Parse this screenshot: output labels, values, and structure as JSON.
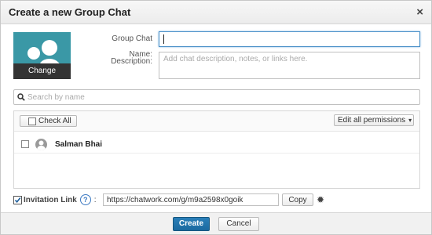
{
  "dialog": {
    "title": "Create a new Group Chat",
    "close_glyph": "×"
  },
  "avatar": {
    "change_label": "Change",
    "icon": "group-avatar-icon"
  },
  "form": {
    "name_label": "Group Chat Name:",
    "name_label_line1": "Group Chat",
    "name_label_line2": "Name:",
    "name_value": "",
    "description_label": "Description:",
    "description_placeholder": "Add chat description, notes, or links here."
  },
  "search": {
    "placeholder": "Search by name",
    "icon": "search-icon"
  },
  "members": {
    "check_all_label": "Check All",
    "edit_permissions_label": "Edit all permissions",
    "dropdown_glyph": "▾",
    "items": [
      {
        "name": "Salman Bhai",
        "checked": false
      }
    ]
  },
  "invite": {
    "label": "Invitation Link",
    "checked": true,
    "help_glyph": "?",
    "colon": ":",
    "link": "https://chatwork.com/g/m9a2598x0goik",
    "copy_label": "Copy",
    "gear_glyph": "✹"
  },
  "footer": {
    "create_label": "Create",
    "cancel_label": "Cancel"
  },
  "colors": {
    "accent": "#1b6aa0",
    "avatar_bg": "#3a98a6",
    "focus": "#4a90c8"
  }
}
